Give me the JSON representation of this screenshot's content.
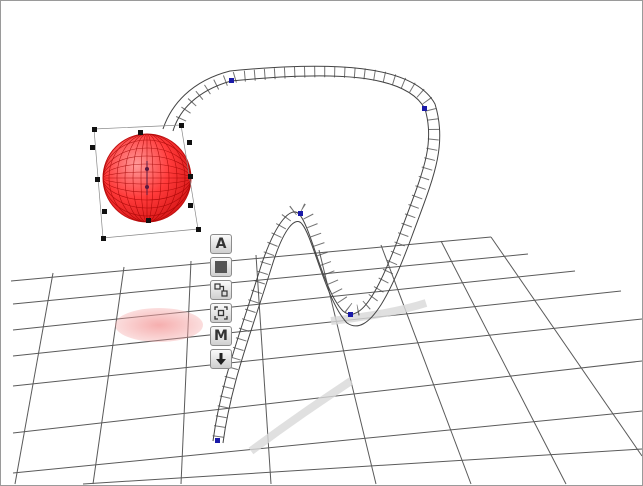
{
  "viewport": {
    "background": "#ffffff",
    "frame_color": "#9a9a9a",
    "grid_color": "#555555",
    "track_color": "#444444",
    "control_point_color": "#1a1aa8",
    "sphere_color": "#ff3030",
    "shadow_color": "#f4a0a0"
  },
  "toolbar": {
    "buttons": [
      {
        "name": "add-text-button",
        "label": "A",
        "icon": "letter-a-icon"
      },
      {
        "name": "solid-fill-button",
        "label": "",
        "icon": "square-fill-icon"
      },
      {
        "name": "connect-nodes-button",
        "label": "",
        "icon": "connect-nodes-icon"
      },
      {
        "name": "fit-selection-button",
        "label": "",
        "icon": "fit-frame-icon"
      },
      {
        "name": "material-button",
        "label": "M",
        "icon": "letter-m-icon"
      },
      {
        "name": "drop-to-ground-button",
        "label": "",
        "icon": "down-arrow-icon"
      }
    ]
  }
}
